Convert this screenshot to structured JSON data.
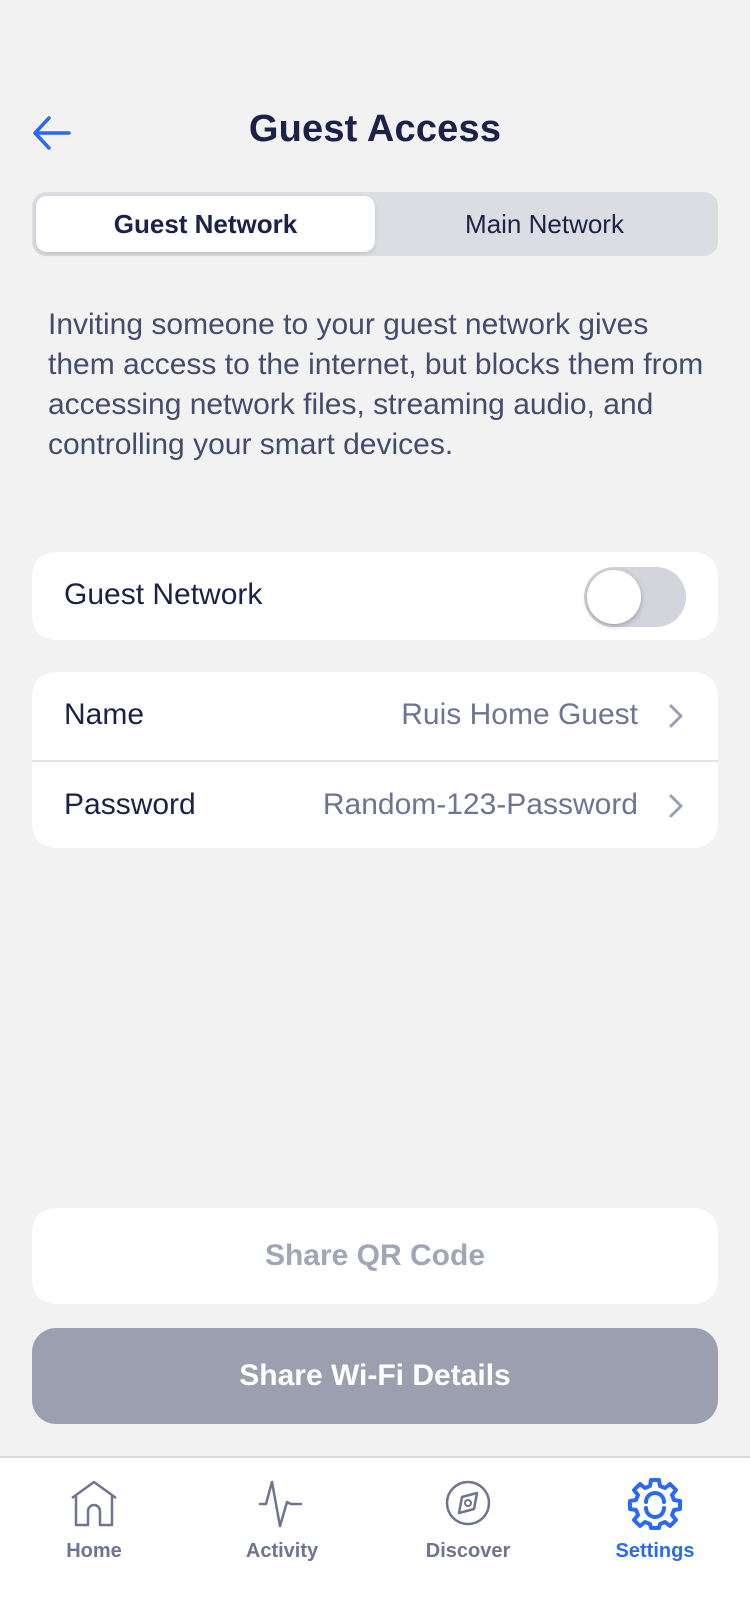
{
  "colors": {
    "accent": "#2a6af2",
    "background": "#f2f2f2",
    "text_primary": "#1b2147",
    "text_secondary": "#6e7492",
    "button_disabled": "#9c9fb0"
  },
  "header": {
    "back_icon": "arrow-left-icon",
    "title": "Guest Access"
  },
  "segments": [
    {
      "label": "Guest Network",
      "selected": true
    },
    {
      "label": "Main Network",
      "selected": false
    }
  ],
  "description": "Inviting someone to your guest network gives them access to the internet, but blocks them from accessing network files, streaming audio, and controlling your smart devices.",
  "guest_toggle": {
    "label": "Guest Network",
    "enabled": false
  },
  "settings_rows": [
    {
      "label": "Name",
      "value": "Ruis Home Guest",
      "icon": "chevron-right-icon"
    },
    {
      "label": "Password",
      "value": "Random-123-Password",
      "icon": "chevron-right-icon"
    }
  ],
  "buttons": {
    "share_qr": "Share QR Code",
    "share_wifi": "Share Wi-Fi Details"
  },
  "tabbar": [
    {
      "label": "Home",
      "icon": "home-icon",
      "active": false
    },
    {
      "label": "Activity",
      "icon": "activity-icon",
      "active": false
    },
    {
      "label": "Discover",
      "icon": "compass-icon",
      "active": false
    },
    {
      "label": "Settings",
      "icon": "gear-icon",
      "active": true
    }
  ]
}
